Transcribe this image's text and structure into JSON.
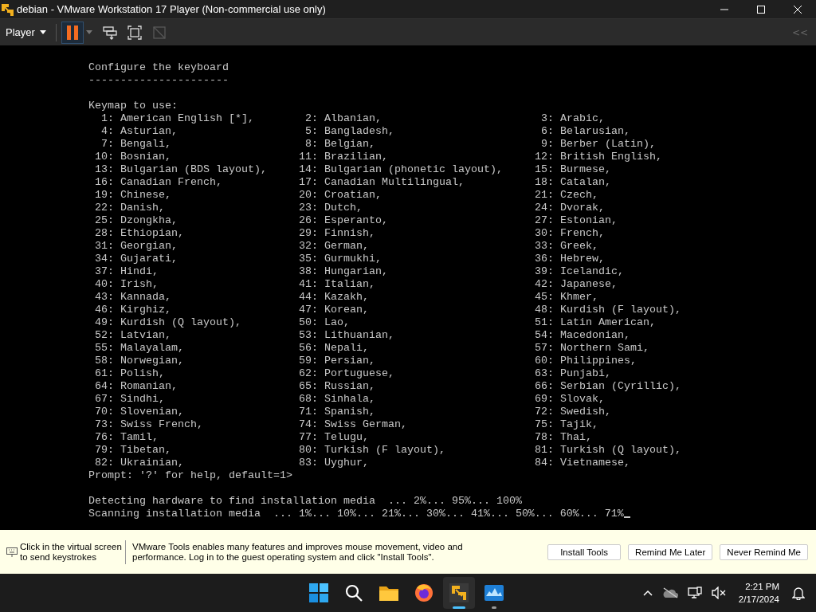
{
  "window": {
    "title": "debian - VMware Workstation 17 Player (Non-commercial use only)"
  },
  "toolbar": {
    "menu": "Player",
    "buttons": [
      {
        "kind": "pause",
        "disabled": false
      },
      {
        "kind": "send-keys",
        "disabled": false
      },
      {
        "kind": "fullscreen",
        "disabled": false
      },
      {
        "kind": "unity",
        "disabled": true
      }
    ],
    "collapse": "<<"
  },
  "console": {
    "title": "Configure the keyboard",
    "underline": "----------------------",
    "heading": "Keymap to use:",
    "rows": [
      [
        {
          "number": "1:",
          "name": "American English [*],"
        },
        {
          "number": "2:",
          "name": "Albanian,"
        },
        {
          "number": "3:",
          "name": "Arabic,"
        }
      ],
      [
        {
          "number": "4:",
          "name": "Asturian,"
        },
        {
          "number": "5:",
          "name": "Bangladesh,"
        },
        {
          "number": "6:",
          "name": "Belarusian,"
        }
      ],
      [
        {
          "number": "7:",
          "name": "Bengali,"
        },
        {
          "number": "8:",
          "name": "Belgian,"
        },
        {
          "number": "9:",
          "name": "Berber (Latin),"
        }
      ],
      [
        {
          "number": "10:",
          "name": "Bosnian,"
        },
        {
          "number": "11:",
          "name": "Brazilian,"
        },
        {
          "number": "12:",
          "name": "British English,"
        }
      ],
      [
        {
          "number": "13:",
          "name": "Bulgarian (BDS layout),"
        },
        {
          "number": "14:",
          "name": "Bulgarian (phonetic layout),"
        },
        {
          "number": "15:",
          "name": "Burmese,"
        }
      ],
      [
        {
          "number": "16:",
          "name": "Canadian French,"
        },
        {
          "number": "17:",
          "name": "Canadian Multilingual,"
        },
        {
          "number": "18:",
          "name": "Catalan,"
        }
      ],
      [
        {
          "number": "19:",
          "name": "Chinese,"
        },
        {
          "number": "20:",
          "name": "Croatian,"
        },
        {
          "number": "21:",
          "name": "Czech,"
        }
      ],
      [
        {
          "number": "22:",
          "name": "Danish,"
        },
        {
          "number": "23:",
          "name": "Dutch,"
        },
        {
          "number": "24:",
          "name": "Dvorak,"
        }
      ],
      [
        {
          "number": "25:",
          "name": "Dzongkha,"
        },
        {
          "number": "26:",
          "name": "Esperanto,"
        },
        {
          "number": "27:",
          "name": "Estonian,"
        }
      ],
      [
        {
          "number": "28:",
          "name": "Ethiopian,"
        },
        {
          "number": "29:",
          "name": "Finnish,"
        },
        {
          "number": "30:",
          "name": "French,"
        }
      ],
      [
        {
          "number": "31:",
          "name": "Georgian,"
        },
        {
          "number": "32:",
          "name": "German,"
        },
        {
          "number": "33:",
          "name": "Greek,"
        }
      ],
      [
        {
          "number": "34:",
          "name": "Gujarati,"
        },
        {
          "number": "35:",
          "name": "Gurmukhi,"
        },
        {
          "number": "36:",
          "name": "Hebrew,"
        }
      ],
      [
        {
          "number": "37:",
          "name": "Hindi,"
        },
        {
          "number": "38:",
          "name": "Hungarian,"
        },
        {
          "number": "39:",
          "name": "Icelandic,"
        }
      ],
      [
        {
          "number": "40:",
          "name": "Irish,"
        },
        {
          "number": "41:",
          "name": "Italian,"
        },
        {
          "number": "42:",
          "name": "Japanese,"
        }
      ],
      [
        {
          "number": "43:",
          "name": "Kannada,"
        },
        {
          "number": "44:",
          "name": "Kazakh,"
        },
        {
          "number": "45:",
          "name": "Khmer,"
        }
      ],
      [
        {
          "number": "46:",
          "name": "Kirghiz,"
        },
        {
          "number": "47:",
          "name": "Korean,"
        },
        {
          "number": "48:",
          "name": "Kurdish (F layout),"
        }
      ],
      [
        {
          "number": "49:",
          "name": "Kurdish (Q layout),"
        },
        {
          "number": "50:",
          "name": "Lao,"
        },
        {
          "number": "51:",
          "name": "Latin American,"
        }
      ],
      [
        {
          "number": "52:",
          "name": "Latvian,"
        },
        {
          "number": "53:",
          "name": "Lithuanian,"
        },
        {
          "number": "54:",
          "name": "Macedonian,"
        }
      ],
      [
        {
          "number": "55:",
          "name": "Malayalam,"
        },
        {
          "number": "56:",
          "name": "Nepali,"
        },
        {
          "number": "57:",
          "name": "Northern Sami,"
        }
      ],
      [
        {
          "number": "58:",
          "name": "Norwegian,"
        },
        {
          "number": "59:",
          "name": "Persian,"
        },
        {
          "number": "60:",
          "name": "Philippines,"
        }
      ],
      [
        {
          "number": "61:",
          "name": "Polish,"
        },
        {
          "number": "62:",
          "name": "Portuguese,"
        },
        {
          "number": "63:",
          "name": "Punjabi,"
        }
      ],
      [
        {
          "number": "64:",
          "name": "Romanian,"
        },
        {
          "number": "65:",
          "name": "Russian,"
        },
        {
          "number": "66:",
          "name": "Serbian (Cyrillic),"
        }
      ],
      [
        {
          "number": "67:",
          "name": "Sindhi,"
        },
        {
          "number": "68:",
          "name": "Sinhala,"
        },
        {
          "number": "69:",
          "name": "Slovak,"
        }
      ],
      [
        {
          "number": "70:",
          "name": "Slovenian,"
        },
        {
          "number": "71:",
          "name": "Spanish,"
        },
        {
          "number": "72:",
          "name": "Swedish,"
        }
      ],
      [
        {
          "number": "73:",
          "name": "Swiss French,"
        },
        {
          "number": "74:",
          "name": "Swiss German,"
        },
        {
          "number": "75:",
          "name": "Tajik,"
        }
      ],
      [
        {
          "number": "76:",
          "name": "Tamil,"
        },
        {
          "number": "77:",
          "name": "Telugu,"
        },
        {
          "number": "78:",
          "name": "Thai,"
        }
      ],
      [
        {
          "number": "79:",
          "name": "Tibetan,"
        },
        {
          "number": "80:",
          "name": "Turkish (F layout),"
        },
        {
          "number": "81:",
          "name": "Turkish (Q layout),"
        }
      ],
      [
        {
          "number": "82:",
          "name": "Ukrainian,"
        },
        {
          "number": "83:",
          "name": "Uyghur,"
        },
        {
          "number": "84:",
          "name": "Vietnamese,"
        }
      ]
    ],
    "prompt": "Prompt: '?' for help, default=1>",
    "progress_lines": [
      "Detecting hardware to find installation media  ... 2%... 95%... 100%",
      "Scanning installation media  ... 1%... 10%... 21%... 30%... 41%... 50%... 60%... 71%"
    ]
  },
  "notification": {
    "hint": "Click in the virtual screen to send keystrokes",
    "message": "VMware Tools enables many features and improves mouse movement, video and performance. Log in to the guest operating system and click \"Install Tools\".",
    "buttons": [
      "Install Tools",
      "Remind Me Later",
      "Never Remind Me"
    ]
  },
  "taskbar": {
    "apps": [
      {
        "kind": "start",
        "active": false,
        "running": false
      },
      {
        "kind": "search",
        "active": false,
        "running": false
      },
      {
        "kind": "folder",
        "active": false,
        "running": false
      },
      {
        "kind": "browser",
        "active": false,
        "running": false
      },
      {
        "kind": "vm",
        "active": true,
        "running": true
      },
      {
        "kind": "monitor",
        "active": false,
        "running": true
      }
    ],
    "time": "2:21 PM",
    "date": "2/17/2024"
  }
}
